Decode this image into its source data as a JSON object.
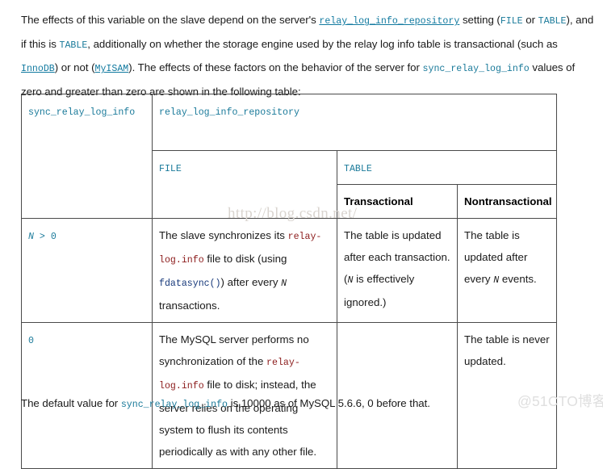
{
  "intro": {
    "seg1": "The effects of this variable on the slave depend on the server's ",
    "link_repo": "relay_log_info_repository",
    "seg2": " setting (",
    "code_file": "FILE",
    "seg3": " or ",
    "code_table_1": "TABLE",
    "seg4": "), and if this is ",
    "code_table_2": "TABLE",
    "seg5": ", additionally on whether the storage engine used by the relay log info table is transactional (such as ",
    "link_innodb": "InnoDB",
    "seg6": ") or not (",
    "link_myisam": "MyISAM",
    "seg7": "). The effects of these factors on the behavior of the server for ",
    "code_sync": "sync_relay_log_info",
    "seg8": " values of zero and greater than zero are shown in the following table:"
  },
  "table": {
    "header": {
      "col_sync": "sync_relay_log_info",
      "col_repo": "relay_log_info_repository",
      "sub_file": "FILE",
      "sub_table": "TABLE",
      "sub_transactional": "Transactional",
      "sub_nontransactional": "Nontransactional"
    },
    "rows": [
      {
        "value_var": "N",
        "value_rest": " > 0",
        "file": {
          "seg1": "The slave synchronizes its ",
          "code1": "relay-log.info",
          "seg2": " file to disk (using ",
          "code2": "fdatasync()",
          "seg3": ") after every ",
          "var": "N",
          "seg4": " transactions."
        },
        "transactional": {
          "seg1": "The table is updated after each transaction. (",
          "var": "N",
          "seg2": " is effectively ignored.)"
        },
        "nontransactional": {
          "seg1": "The table is updated after every ",
          "var": "N",
          "seg2": " events."
        }
      },
      {
        "value_var": "",
        "value_rest": "0",
        "file": {
          "seg1": "The MySQL server performs no synchronization of the ",
          "code1": "relay-log.info",
          "seg2": " file to disk; instead, the server relies on the operating system to flush its contents periodically as with any other file.",
          "code2": "",
          "seg3": "",
          "var": "",
          "seg4": ""
        },
        "transactional": {
          "seg1": "",
          "var": "",
          "seg2": ""
        },
        "nontransactional": {
          "seg1": "The table is never updated.",
          "var": "",
          "seg2": ""
        }
      }
    ]
  },
  "footer": {
    "seg1": "The default value for ",
    "code_sync": "sync_relay_log_info",
    "seg2": " is 10000 as of MySQL 5.6.6, 0 before that."
  },
  "watermarks": {
    "csdn": "http://blog.csdn.net/",
    "cto": "@51CTO博客"
  },
  "colors": {
    "code_teal": "#1a7a9a",
    "code_link": "#127aa0",
    "code_red": "#8b1a1a",
    "code_navy": "#16387a",
    "border": "#4a4a4a",
    "text": "#1a1a1a"
  }
}
